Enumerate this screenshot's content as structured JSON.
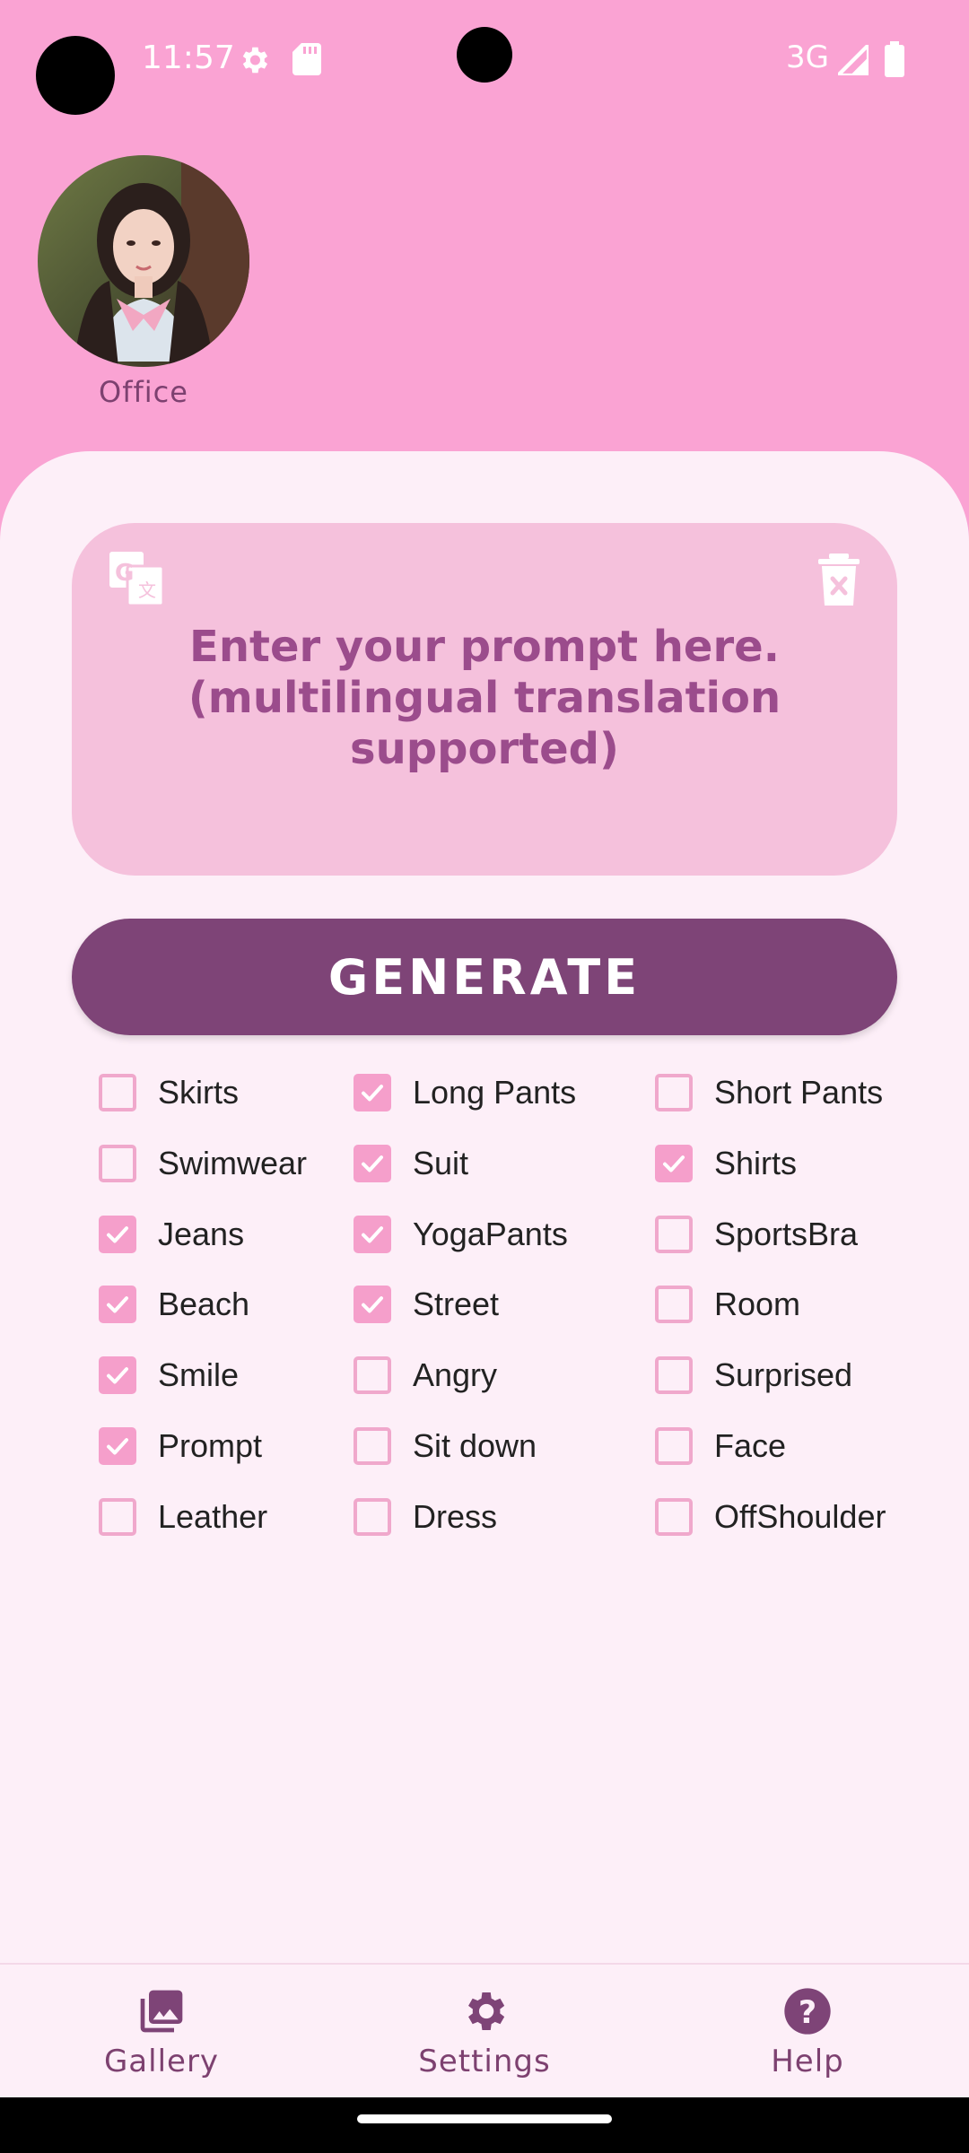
{
  "status_bar": {
    "time": "11:57",
    "network": "3G",
    "icons": [
      "settings-gear-icon",
      "sd-card-icon",
      "signal-icon",
      "battery-icon"
    ]
  },
  "profile": {
    "label": "Office",
    "avatar": "portrait-photo"
  },
  "prompt": {
    "placeholder": "Enter your prompt here. (multilingual translation supported)",
    "icons": [
      "translate-icon",
      "trash-icon"
    ]
  },
  "generate": {
    "label": "GENERATE"
  },
  "options": {
    "col1": [
      {
        "label": "Skirts",
        "checked": false
      },
      {
        "label": "Swimwear",
        "checked": false
      },
      {
        "label": "Jeans",
        "checked": true
      },
      {
        "label": "Beach",
        "checked": true
      },
      {
        "label": "Smile",
        "checked": true
      },
      {
        "label": "Prompt",
        "checked": true
      },
      {
        "label": "Leather",
        "checked": false
      }
    ],
    "col2": [
      {
        "label": "Long Pants",
        "checked": true
      },
      {
        "label": "Suit",
        "checked": true
      },
      {
        "label": "YogaPants",
        "checked": true
      },
      {
        "label": "Street",
        "checked": true
      },
      {
        "label": "Angry",
        "checked": false
      },
      {
        "label": "Sit down",
        "checked": false
      },
      {
        "label": "Dress",
        "checked": false
      }
    ],
    "col3": [
      {
        "label": "Short Pants",
        "checked": false
      },
      {
        "label": "Shirts",
        "checked": true
      },
      {
        "label": "SportsBra",
        "checked": false
      },
      {
        "label": "Room",
        "checked": false
      },
      {
        "label": "Surprised",
        "checked": false
      },
      {
        "label": "Face",
        "checked": false
      },
      {
        "label": "OffShoulder",
        "checked": false
      }
    ]
  },
  "nav": {
    "gallery": "Gallery",
    "settings": "Settings",
    "help": "Help"
  },
  "colors": {
    "header_pink": "#faa3d3",
    "sheet_bg": "#fdeff8",
    "prompt_bg": "#f5c1dc",
    "accent_purple": "#7e4477",
    "checkbox_pink": "#f59fcb"
  }
}
